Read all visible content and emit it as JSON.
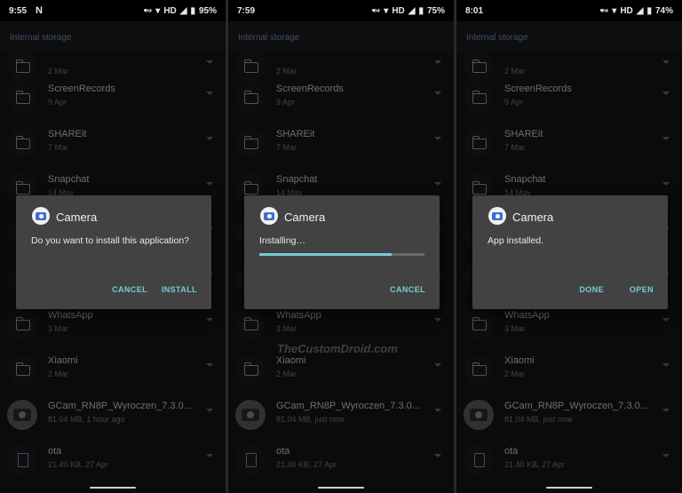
{
  "header": {
    "breadcrumb": "Internal storage"
  },
  "watermark": "TheCustomDroid.com",
  "files": [
    {
      "kind": "folder",
      "name": "",
      "meta": "2 Mar"
    },
    {
      "kind": "folder",
      "name": "ScreenRecords",
      "meta": "9 Apr"
    },
    {
      "kind": "folder",
      "name": "SHAREit",
      "meta": "7 Mar"
    },
    {
      "kind": "folder",
      "name": "Snapchat",
      "meta": "14 May"
    },
    {
      "kind": "folder",
      "name": "",
      "meta": ""
    },
    {
      "kind": "folder",
      "name": "",
      "meta": ""
    },
    {
      "kind": "folder",
      "name": "WhatsApp",
      "meta": "3 Mar"
    },
    {
      "kind": "folder",
      "name": "Xiaomi",
      "meta": "2 Mar"
    },
    {
      "kind": "apk",
      "name": "GCam_RN8P_Wyroczen_7.3.0..."
    },
    {
      "kind": "file",
      "name": "ota",
      "meta": "21.40 KB, 27 Apr"
    }
  ],
  "screens": [
    {
      "status": {
        "time": "9:55",
        "notif": "N",
        "hd": "HD",
        "battery": "95%"
      },
      "apk_meta": "81.04 MB, 1 hour ago",
      "dialog": {
        "app_name": "Camera",
        "message": "Do you want to install this application?",
        "progress": null,
        "buttons": [
          {
            "label": "CANCEL"
          },
          {
            "label": "INSTALL"
          }
        ]
      }
    },
    {
      "status": {
        "time": "7:59",
        "notif": "",
        "hd": "HD",
        "battery": "75%"
      },
      "apk_meta": "81.04 MB, just now",
      "dialog": {
        "app_name": "Camera",
        "message": "Installing…",
        "progress": 0.8,
        "buttons": [
          {
            "label": "CANCEL"
          }
        ]
      }
    },
    {
      "status": {
        "time": "8:01",
        "notif": "",
        "hd": "HD",
        "battery": "74%"
      },
      "apk_meta": "81.04 MB, just now",
      "dialog": {
        "app_name": "Camera",
        "message": "App installed.",
        "progress": null,
        "buttons": [
          {
            "label": "DONE"
          },
          {
            "label": "OPEN"
          }
        ]
      }
    }
  ],
  "colors": {
    "accent": "#7bc9d6",
    "dialog_bg": "#424242",
    "breadcrumb": "#6f8fbf"
  },
  "icons": {
    "status": [
      "bluetooth-icon",
      "wifi-icon",
      "signal-icon",
      "battery-icon"
    ],
    "folder": "folder-icon",
    "apk": "camera-icon",
    "file": "file-icon"
  }
}
